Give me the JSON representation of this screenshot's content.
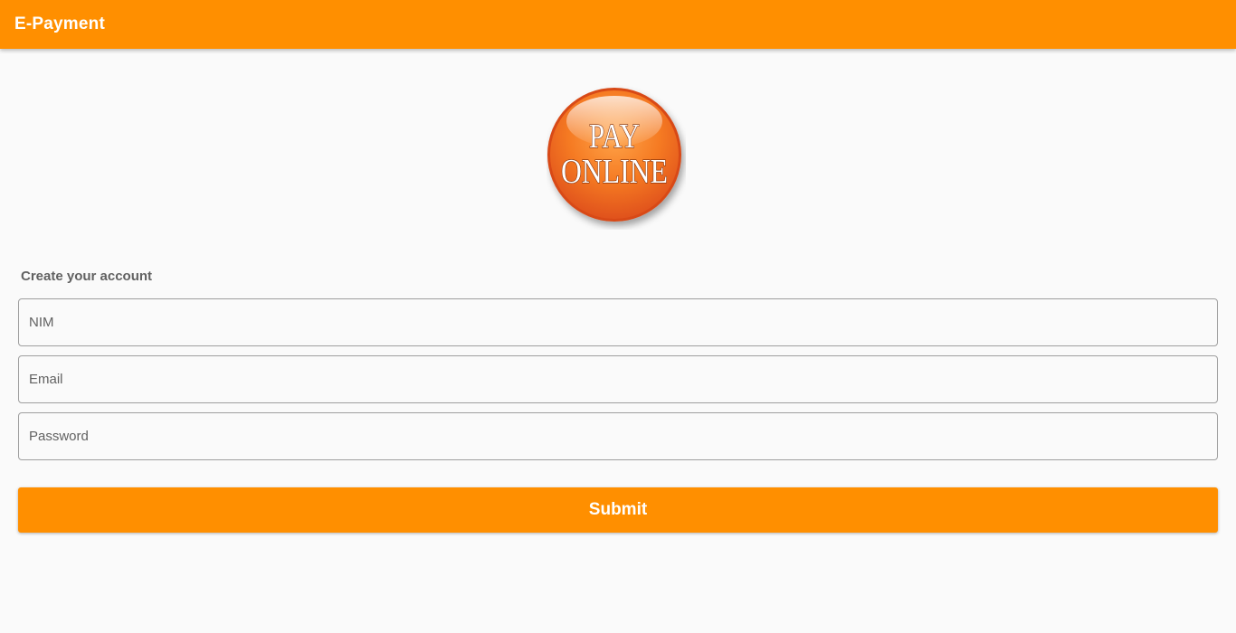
{
  "app_bar": {
    "title": "E-Payment",
    "color": "#ff8f00"
  },
  "logo": {
    "line1": "PAY",
    "line2": "ONLINE"
  },
  "form": {
    "heading": "Create your account",
    "fields": [
      {
        "placeholder": "NIM",
        "value": ""
      },
      {
        "placeholder": "Email",
        "value": ""
      },
      {
        "placeholder": "Password",
        "value": ""
      }
    ],
    "submit_label": "Submit"
  }
}
